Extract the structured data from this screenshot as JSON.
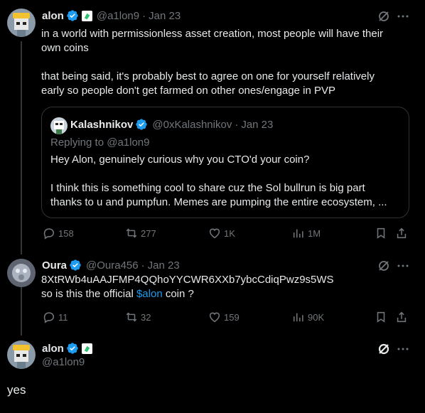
{
  "tweet1": {
    "name": "alon",
    "handle": "@a1lon9",
    "dot": "·",
    "date": "Jan 23",
    "text_line1": "in a world with permissionless asset creation, most people will have their",
    "text_line2": "own coins",
    "text_line3": "that being said, it's probably best to agree on one for yourself relatively",
    "text_line4": "early so people don't get farmed on other ones/engage in PVP",
    "quote": {
      "name": "Kalashnikov",
      "handle": "@0xKalashnikov",
      "dot": "·",
      "date": "Jan 23",
      "replying_prefix": "Replying to ",
      "replying_handle": "@a1lon9",
      "line1": "Hey Alon, genuinely curious why you CTO'd your coin?",
      "line2": "I think this is something cool to share cuz the Sol bullrun is big part",
      "line3": "thanks to u and pumpfun. Memes are pumping the entire ecosystem, ..."
    },
    "stats": {
      "replies": "158",
      "reposts": "277",
      "likes": "1K",
      "views": "1M"
    }
  },
  "tweet2": {
    "name": "Oura",
    "handle": "@Oura456",
    "dot": "·",
    "date": "Jan 23",
    "line1": "8XtRWb4uAAJFMP4QQhoYYCWR6XXb7ybcCdiqPwz9s5WS",
    "line2_prefix": "so is this the official ",
    "line2_link": "$alon",
    "line2_suffix": " coin ?",
    "stats": {
      "replies": "11",
      "reposts": "32",
      "likes": "159",
      "views": "90K"
    }
  },
  "main": {
    "name": "alon",
    "handle": "@a1lon9",
    "text": "yes"
  },
  "colors": {
    "background": "#000000",
    "text": "#e7e9ea",
    "muted": "#71767b",
    "link": "#1d9bf0",
    "verified": "#1d9bf0",
    "border": "#2f3336"
  }
}
